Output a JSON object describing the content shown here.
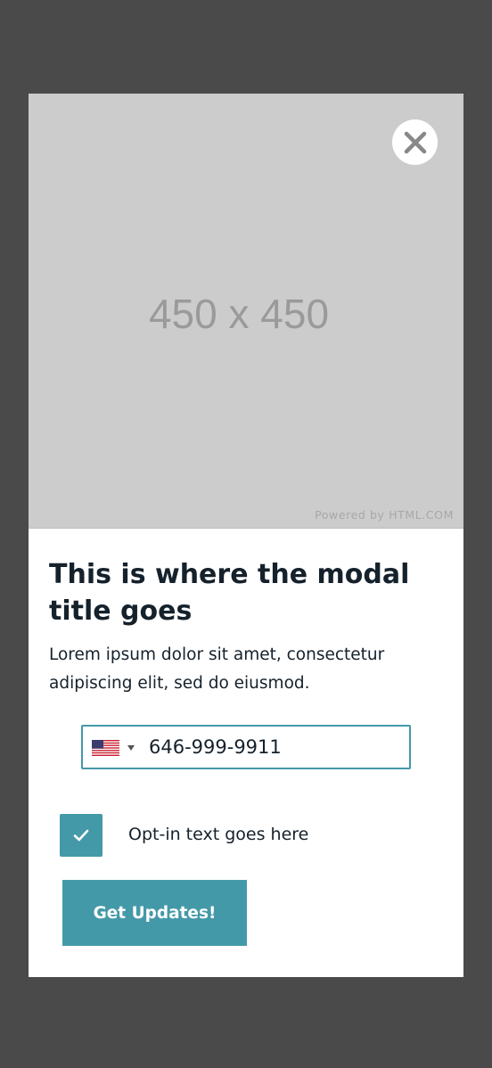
{
  "hero": {
    "placeholder_text": "450 x 450",
    "credit": "Powered by HTML.COM"
  },
  "close_button": {
    "icon": "close-icon"
  },
  "modal": {
    "title": "This is where the modal title goes",
    "description": "Lorem ipsum dolor sit amet, consectetur adipiscing elit, sed do eiusmod."
  },
  "phone": {
    "country_icon": "us-flag-icon",
    "value": "646-999-9911"
  },
  "optin": {
    "checked": true,
    "label": "Opt-in text goes here"
  },
  "submit": {
    "label": "Get Updates!"
  },
  "colors": {
    "backdrop": "#4a4a4a",
    "accent": "#4499a8",
    "text": "#15212b",
    "placeholder_bg": "#cccccc"
  }
}
